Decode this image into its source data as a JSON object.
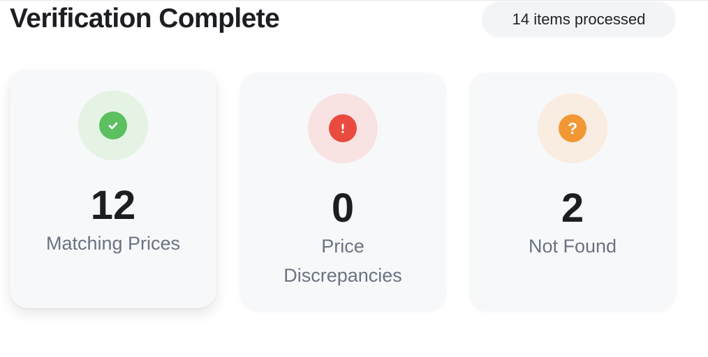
{
  "header": {
    "title": "Verification Complete",
    "processed_badge": "14 items processed"
  },
  "cards": [
    {
      "icon": "check-icon",
      "value": "12",
      "label": "Matching Prices",
      "accent": "#5cbf60",
      "halo": "#e4f3e4"
    },
    {
      "icon": "exclamation-icon",
      "value": "0",
      "label": "Price Discrepancies",
      "accent": "#ea4b3f",
      "halo": "#f8e3e2"
    },
    {
      "icon": "question-icon",
      "value": "2",
      "label": "Not Found",
      "accent": "#f19834",
      "halo": "#f9ece0",
      "glyph": "?"
    }
  ]
}
